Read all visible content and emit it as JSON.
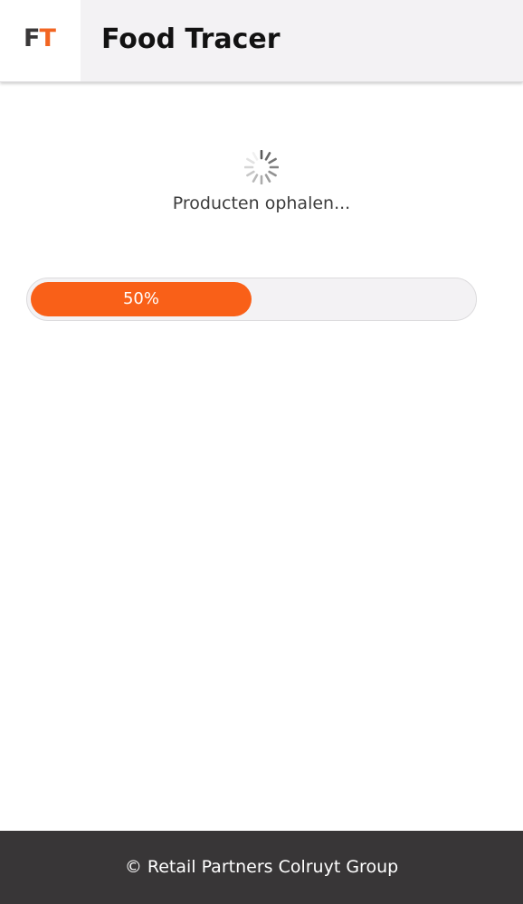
{
  "header": {
    "logo_letters": [
      "F",
      "T"
    ],
    "title": "Food Tracer"
  },
  "loading": {
    "status": "Producten ophalen...",
    "progress_percent": 50,
    "progress_label": "50%"
  },
  "footer": {
    "copyright": "© Retail Partners Colruyt Group"
  },
  "colors": {
    "accent": "#f96018",
    "logo_f": "#3a3839",
    "logo_t": "#f26522",
    "header_bg": "#f3f2f4",
    "footer_bg": "#383637"
  },
  "icons": [
    "loading-spinner-icon"
  ]
}
